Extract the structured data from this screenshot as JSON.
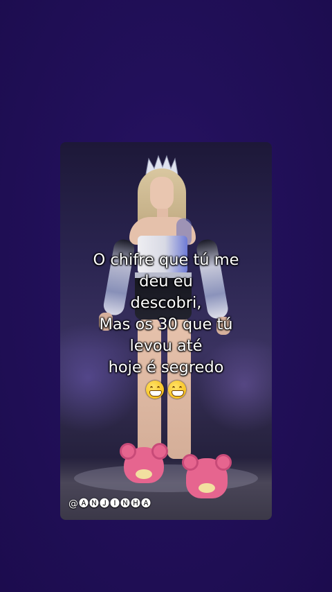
{
  "caption": {
    "lines": [
      "O chifre que tú me",
      "deu eu",
      "descobri,",
      "Mas os 30 que tú",
      "levou até",
      "hoje é segredo"
    ],
    "emoji": "😁😁"
  },
  "watermark": {
    "text": "@🅐🅝🅙🅘🅝🅗🅐"
  },
  "colors": {
    "background": "#1f0e55",
    "caption_text": "#ffffff",
    "slippers": "#e6658f"
  }
}
